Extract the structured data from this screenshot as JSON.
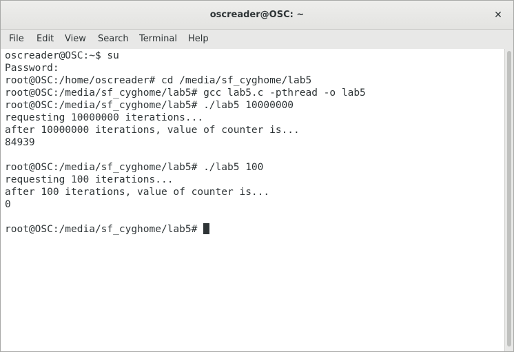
{
  "window": {
    "title": "oscreader@OSC: ~",
    "close_glyph": "✕"
  },
  "menu": [
    {
      "label": "File"
    },
    {
      "label": "Edit"
    },
    {
      "label": "View"
    },
    {
      "label": "Search"
    },
    {
      "label": "Terminal"
    },
    {
      "label": "Help"
    }
  ],
  "terminal": {
    "lines": [
      "oscreader@OSC:~$ su",
      "Password:",
      "root@OSC:/home/oscreader# cd /media/sf_cyghome/lab5",
      "root@OSC:/media/sf_cyghome/lab5# gcc lab5.c -pthread -o lab5",
      "root@OSC:/media/sf_cyghome/lab5# ./lab5 10000000",
      "requesting 10000000 iterations...",
      "after 10000000 iterations, value of counter is...",
      "84939",
      "",
      "root@OSC:/media/sf_cyghome/lab5# ./lab5 100",
      "requesting 100 iterations...",
      "after 100 iterations, value of counter is...",
      "0",
      ""
    ],
    "prompt": "root@OSC:/media/sf_cyghome/lab5# "
  }
}
